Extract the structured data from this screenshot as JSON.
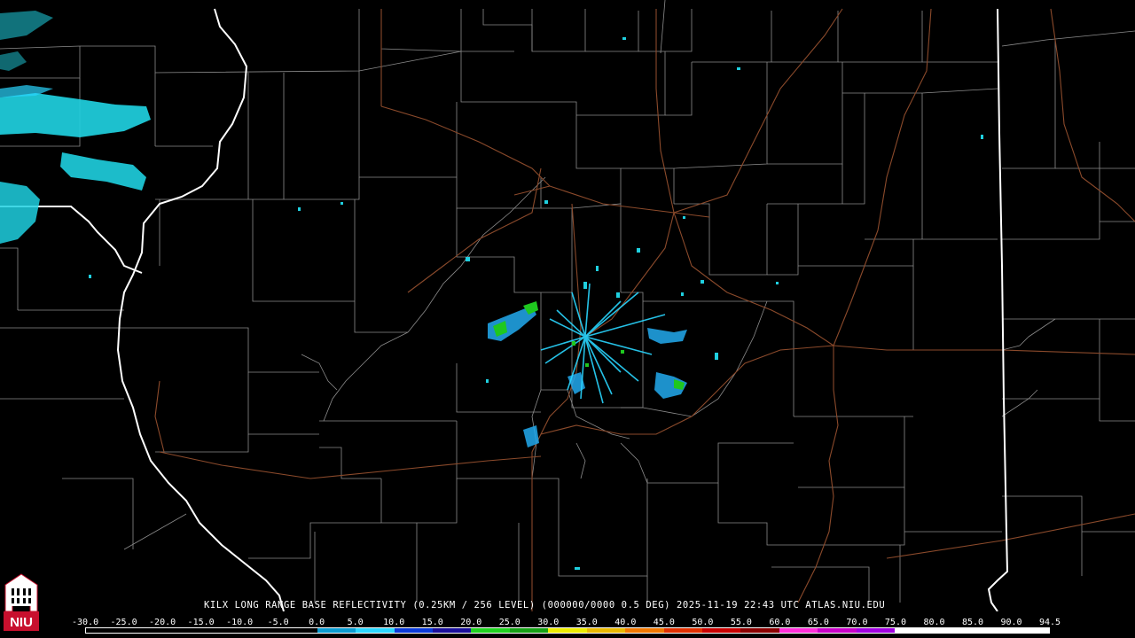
{
  "product_line": "KILX LONG RANGE BASE REFLECTIVITY (0.25KM / 256 LEVEL) (000000/0000 0.5 DEG) 2025-11-19 22:43 UTC  ATLAS.NIU.EDU",
  "logo_text": "NIU",
  "colors": {
    "background": "#000000",
    "county_lines": "#8c8c8c",
    "state_lines": "#ffffff",
    "highways": "#8b4a2b",
    "logo_red": "#c8102e"
  },
  "legend": {
    "scale_labels": [
      "-30.0",
      "-25.0",
      "-20.0",
      "-15.0",
      "-10.0",
      "-5.0",
      "0.0",
      "5.0",
      "10.0",
      "15.0",
      "20.0",
      "25.0",
      "30.0",
      "35.0",
      "40.0",
      "45.0",
      "50.0",
      "55.0",
      "60.0",
      "65.0",
      "70.0",
      "75.0",
      "80.0",
      "85.0",
      "90.0",
      "94.5"
    ],
    "bar_colors": [
      "#000000",
      "#000000",
      "#000000",
      "#000000",
      "#000000",
      "#000000",
      "#0a9bd0",
      "#2ad6ff",
      "#0a3ad8",
      "#1a0f9a",
      "#1fd21f",
      "#15a015",
      "#ecec00",
      "#e8b800",
      "#f07800",
      "#e03000",
      "#c80000",
      "#8a0000",
      "#ff2ed8",
      "#c800c8",
      "#a000e0",
      "#ffffff",
      "#ffffff",
      "#ffffff",
      "#ffffff"
    ]
  }
}
